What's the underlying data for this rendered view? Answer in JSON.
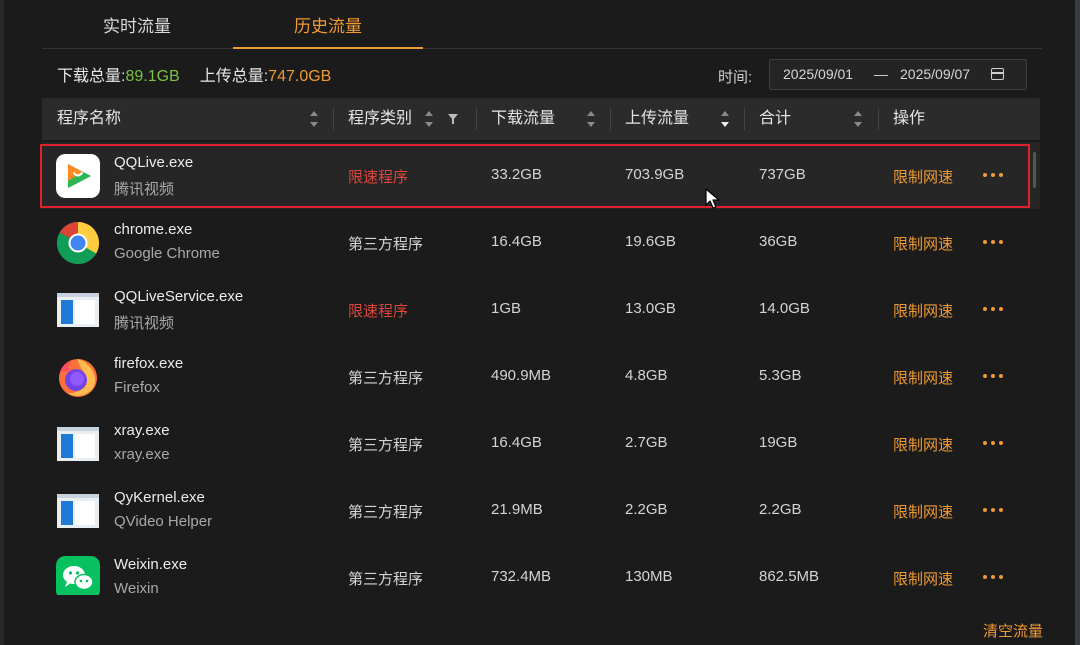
{
  "tabs": [
    {
      "label": "实时流量"
    },
    {
      "label": "历史流量"
    }
  ],
  "summary": {
    "download_label": "下载总量:",
    "download_value": "89.1GB",
    "upload_label": "上传总量:",
    "upload_value": "747.0GB"
  },
  "time_filter": {
    "label": "时间:",
    "start": "2025/09/01",
    "separator": "—",
    "end": "2025/09/07"
  },
  "columns": [
    "程序名称",
    "程序类别",
    "下载流量",
    "上传流量",
    "合计",
    "操作"
  ],
  "rows": [
    {
      "name": "QQLive.exe",
      "desc": "腾讯视频",
      "category": "限速程序",
      "download": "33.2GB",
      "upload": "703.9GB",
      "total": "737GB",
      "action": "限制网速",
      "icon": "qqlive-icon"
    },
    {
      "name": "chrome.exe",
      "desc": "Google Chrome",
      "category": "第三方程序",
      "download": "16.4GB",
      "upload": "19.6GB",
      "total": "36GB",
      "action": "限制网速",
      "icon": "chrome-icon"
    },
    {
      "name": "QQLiveService.exe",
      "desc": "腾讯视频",
      "category": "限速程序",
      "download": "1GB",
      "upload": "13.0GB",
      "total": "14.0GB",
      "action": "限制网速",
      "icon": "generic-exe-icon"
    },
    {
      "name": "firefox.exe",
      "desc": "Firefox",
      "category": "第三方程序",
      "download": "490.9MB",
      "upload": "4.8GB",
      "total": "5.3GB",
      "action": "限制网速",
      "icon": "firefox-icon"
    },
    {
      "name": "xray.exe",
      "desc": "xray.exe",
      "category": "第三方程序",
      "download": "16.4GB",
      "upload": "2.7GB",
      "total": "19GB",
      "action": "限制网速",
      "icon": "generic-exe-icon"
    },
    {
      "name": "QyKernel.exe",
      "desc": "QVideo Helper",
      "category": "第三方程序",
      "download": "21.9MB",
      "upload": "2.2GB",
      "total": "2.2GB",
      "action": "限制网速",
      "icon": "generic-exe-icon"
    },
    {
      "name": "Weixin.exe",
      "desc": "Weixin",
      "category": "第三方程序",
      "download": "732.4MB",
      "upload": "130MB",
      "total": "862.5MB",
      "action": "限制网速",
      "icon": "weixin-icon"
    }
  ],
  "footer": {
    "clear_label": "清空流量"
  },
  "colors": {
    "accent": "#f09a32",
    "download_total": "#7cc243",
    "limited_category": "#e0443a",
    "selection_border": "#e1222e",
    "background": "#1b1b1b"
  }
}
